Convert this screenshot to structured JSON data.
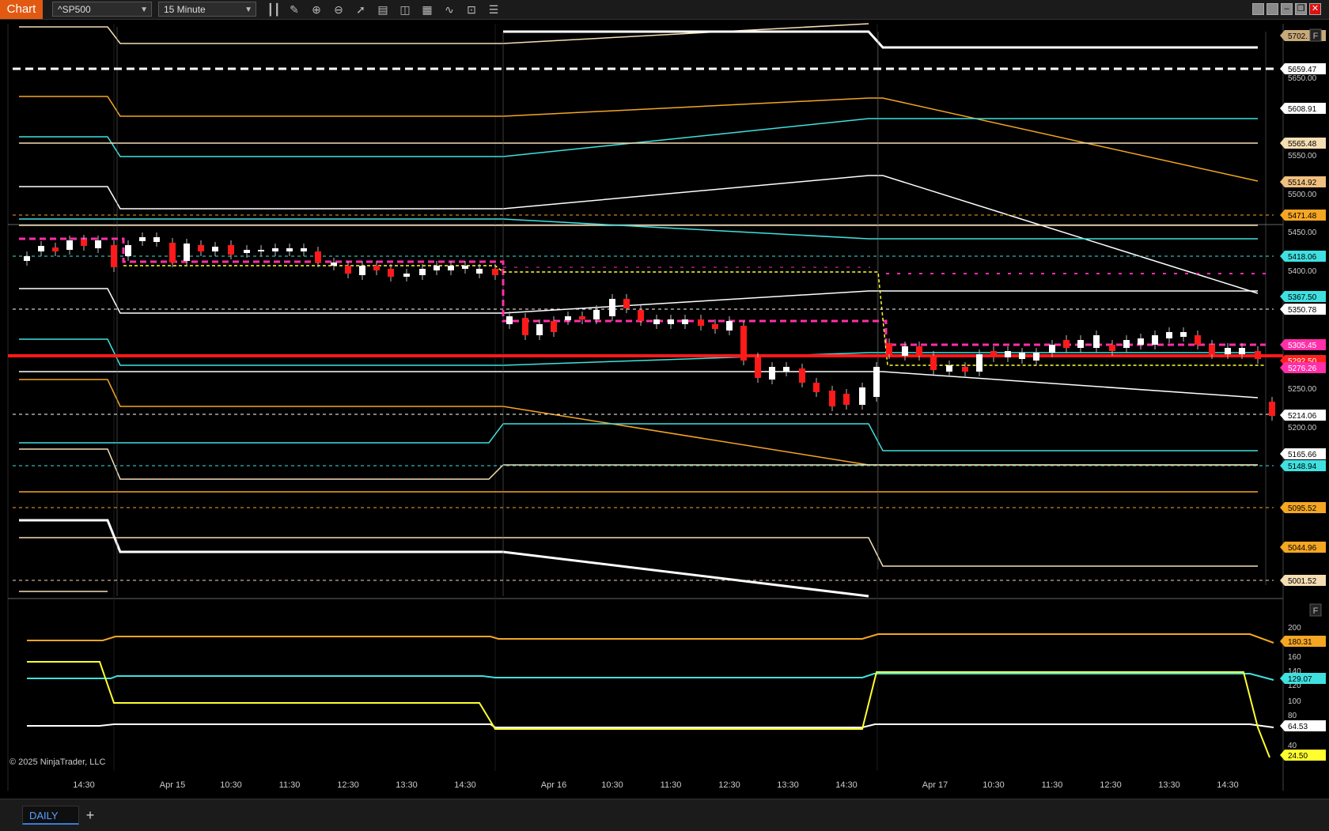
{
  "toolbar": {
    "chart_tab": "Chart",
    "instrument": "^SP500",
    "interval": "15 Minute",
    "tools": [
      "bar-type-icon",
      "pencil-icon",
      "zoom-in-icon",
      "zoom-out-icon",
      "pointer-icon",
      "data-box-icon",
      "properties-icon",
      "templates-icon",
      "strategies-icon",
      "indicators-icon",
      "list-icon"
    ]
  },
  "price_axis": {
    "ticks": [
      "5650.00",
      "5550.00",
      "5500.00",
      "5450.00",
      "5400.00",
      "5250.00",
      "5200.00"
    ],
    "labels": [
      {
        "text": "5702.",
        "bg": "#c8aa7a",
        "fg": "#000"
      },
      {
        "text": "5659.47",
        "bg": "#ffffff",
        "fg": "#000"
      },
      {
        "text": "5608.91",
        "bg": "#ffffff",
        "fg": "#000"
      },
      {
        "text": "5565.48",
        "bg": "#f5deb3",
        "fg": "#000"
      },
      {
        "text": "5514.92",
        "bg": "#f0c080",
        "fg": "#000"
      },
      {
        "text": "5471.48",
        "bg": "#f5a623",
        "fg": "#000"
      },
      {
        "text": "5418.06",
        "bg": "#40e0e0",
        "fg": "#000"
      },
      {
        "text": "5367.50",
        "bg": "#40e0e0",
        "fg": "#000"
      },
      {
        "text": "5350.78",
        "bg": "#ffffff",
        "fg": "#000"
      },
      {
        "text": "5305.45",
        "bg": "#ff2fa8",
        "fg": "#fff"
      },
      {
        "text": "5292.50",
        "bg": "#ff2020",
        "fg": "#fff"
      },
      {
        "text": "5276.26",
        "bg": "#ff2fa8",
        "fg": "#fff"
      },
      {
        "text": "5214.06",
        "bg": "#ffffff",
        "fg": "#000"
      },
      {
        "text": "5165.66",
        "bg": "#ffffff",
        "fg": "#000"
      },
      {
        "text": "5148.94",
        "bg": "#40e0e0",
        "fg": "#000"
      },
      {
        "text": "5095.52",
        "bg": "#f5a623",
        "fg": "#000"
      },
      {
        "text": "5044.96",
        "bg": "#f5a623",
        "fg": "#000"
      },
      {
        "text": "5001.52",
        "bg": "#f5deb3",
        "fg": "#000"
      }
    ]
  },
  "indicator_axis": {
    "ticks": [
      "200",
      "160",
      "140",
      "120",
      "100",
      "80",
      "40"
    ],
    "labels": [
      {
        "text": "180.31",
        "bg": "#f5a623",
        "fg": "#000"
      },
      {
        "text": "129.07",
        "bg": "#40e0e0",
        "fg": "#000"
      },
      {
        "text": "64.53",
        "bg": "#ffffff",
        "fg": "#000"
      },
      {
        "text": "24.50",
        "bg": "#ffff30",
        "fg": "#000"
      }
    ]
  },
  "time_axis": [
    "14:30",
    "Apr 15",
    "10:30",
    "11:30",
    "12:30",
    "13:30",
    "14:30",
    "Apr 16",
    "10:30",
    "11:30",
    "12:30",
    "13:30",
    "14:30",
    "Apr 17",
    "10:30",
    "11:30",
    "12:30",
    "13:30",
    "14:30"
  ],
  "copyright": "© 2025 NinjaTrader, LLC",
  "panel_buttons": {
    "price_panel": "F",
    "indicator_panel": "F"
  },
  "bottom_tabs": {
    "active": "DAILY",
    "add": "+"
  },
  "colors": {
    "accent": "#e25a12",
    "up_candle": "#ffffff",
    "down_candle": "#ff1a1a",
    "pivot_red": "#ff1a1a",
    "magenta": "#ff2fa8",
    "orange": "#f5a623",
    "cyan": "#40e0e0",
    "wheat": "#f5deb3",
    "yellow": "#ffff30"
  }
}
